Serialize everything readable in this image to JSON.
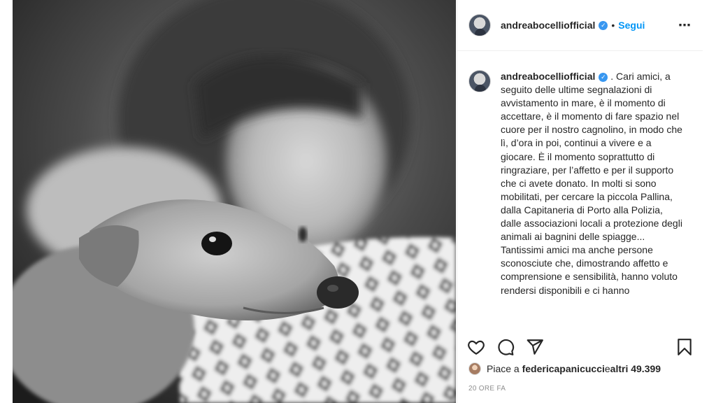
{
  "post": {
    "username": "andreabocelliofficial",
    "follow_label": "Segui",
    "separator": "•",
    "more_icon": "⋯",
    "verified_icon": "✓"
  },
  "caption": {
    "username": "andreabocelliofficial",
    "suffix": " .",
    "text": "Cari amici, a seguito delle ultime segnalazioni di avvistamento in mare, è il momento di accettare, è il momento di fare spazio nel cuore per il nostro cagnolino, in modo che lì, d’ora in poi, continui a vivere e a giocare. È il momento soprattutto di ringraziare, per l’affetto e per il supporto che ci avete donato. In molti si sono mobilitati, per cercare la piccola Pallina, dalla Capitaneria di Porto alla Polizia, dalle associazioni locali a protezione degli animali ai bagnini delle spiagge... Tantissimi amici ma anche persone sconosciute che, dimostrando affetto e comprensione e sensibilità, hanno voluto rendersi disponibili e ci hanno"
  },
  "likes": {
    "prefix": "Piace a ",
    "user": "federicapanicucci",
    "middle": " e ",
    "others": "altri 49.399"
  },
  "timestamp": "20 ORE FA",
  "icons": {
    "like": "heart-icon",
    "comment": "comment-icon",
    "share": "send-icon",
    "save": "bookmark-icon"
  }
}
